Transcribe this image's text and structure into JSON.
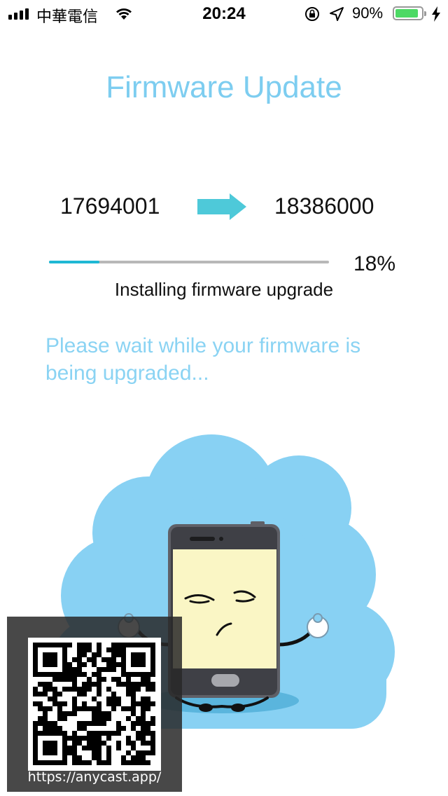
{
  "status_bar": {
    "carrier": "中華電信",
    "time": "20:24",
    "battery_percent": "90%",
    "battery_level": 0.9,
    "icons": [
      "signal-icon",
      "wifi-icon",
      "orientation-lock-icon",
      "location-icon",
      "battery-icon",
      "charging-bolt-icon"
    ]
  },
  "page": {
    "title": "Firmware Update",
    "version_from": "17694001",
    "version_to": "18386000",
    "progress_value": 18,
    "progress_label": "18%",
    "status": "Installing firmware upgrade",
    "wait_message": "Please wait while your firmware is being upgraded..."
  },
  "overlay": {
    "url": "https://anycast.app/"
  },
  "colors": {
    "title": "#7dcdf0",
    "accent": "#4ec9d9",
    "progress_fill": "#1fb8d4",
    "cloud": "#88d1f3"
  }
}
